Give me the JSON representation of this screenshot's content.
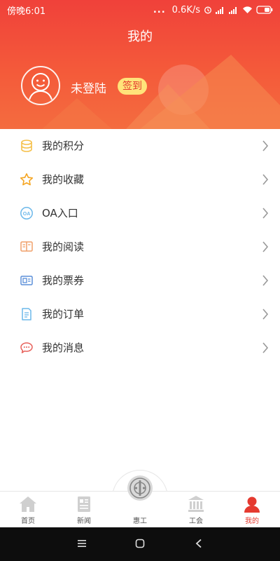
{
  "status_bar": {
    "time": "傍晚6:01",
    "more": "...",
    "network_speed": "0.6K/s",
    "icons": [
      "alarm-icon",
      "signal-icon",
      "signal-icon",
      "wifi-icon",
      "battery-icon"
    ]
  },
  "header": {
    "title": "我的",
    "login_text": "未登陆",
    "signin_label": "签到",
    "colors": {
      "top": "#f0413a",
      "bottom": "#f46c3f",
      "badge": "#ffe37a"
    }
  },
  "menu": [
    {
      "label": "我的积分",
      "icon": "coins-icon",
      "color": "#f5c04a"
    },
    {
      "label": "我的收藏",
      "icon": "star-icon",
      "color": "#f5a623"
    },
    {
      "label": "OA入口",
      "icon": "oa-icon",
      "color": "#6cb8ea"
    },
    {
      "label": "我的阅读",
      "icon": "book-icon",
      "color": "#f0a06a"
    },
    {
      "label": "我的票券",
      "icon": "ticket-icon",
      "color": "#5b8fd9"
    },
    {
      "label": "我的订单",
      "icon": "order-icon",
      "color": "#6cb8ea"
    },
    {
      "label": "我的消息",
      "icon": "message-icon",
      "color": "#e7605a"
    }
  ],
  "bottom_nav": [
    {
      "label": "首页",
      "icon": "home-icon",
      "active": false
    },
    {
      "label": "新闻",
      "icon": "news-icon",
      "active": false
    },
    {
      "label": "惠工",
      "icon": "union-logo-icon",
      "active": false
    },
    {
      "label": "工会",
      "icon": "building-icon",
      "active": false
    },
    {
      "label": "我的",
      "icon": "user-icon",
      "active": true
    }
  ],
  "accent_color": "#e53a30"
}
